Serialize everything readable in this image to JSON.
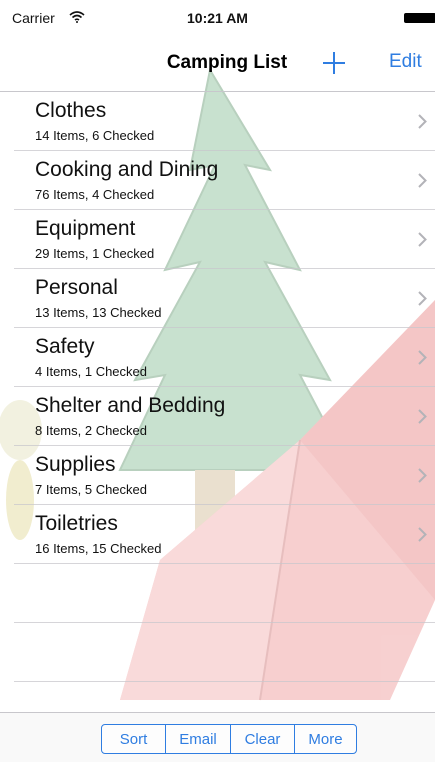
{
  "status_bar": {
    "carrier": "Carrier",
    "time": "10:21 AM",
    "wifi_icon": "wifi-icon",
    "battery_icon": "battery-icon"
  },
  "nav": {
    "title": "Camping List",
    "add_icon": "plus-icon",
    "edit_label": "Edit"
  },
  "list": {
    "items": [
      {
        "title": "Clothes",
        "subtitle": "14 Items, 6 Checked"
      },
      {
        "title": "Cooking and Dining",
        "subtitle": "76 Items, 4 Checked"
      },
      {
        "title": "Equipment",
        "subtitle": "29 Items, 1 Checked"
      },
      {
        "title": "Personal",
        "subtitle": "13 Items, 13 Checked"
      },
      {
        "title": "Safety",
        "subtitle": "4 Items, 1 Checked"
      },
      {
        "title": "Shelter and Bedding",
        "subtitle": "8 Items, 2 Checked"
      },
      {
        "title": "Supplies",
        "subtitle": "7 Items, 5 Checked"
      },
      {
        "title": "Toiletries",
        "subtitle": "16 Items, 15 Checked"
      }
    ]
  },
  "toolbar": {
    "sort_label": "Sort",
    "email_label": "Email",
    "clear_label": "Clear",
    "more_label": "More"
  },
  "colors": {
    "accent": "#2f7de1",
    "tree_green": "#b9d8c2",
    "tent_red": "#f2b6b6",
    "separator": "#c8c7cc"
  }
}
